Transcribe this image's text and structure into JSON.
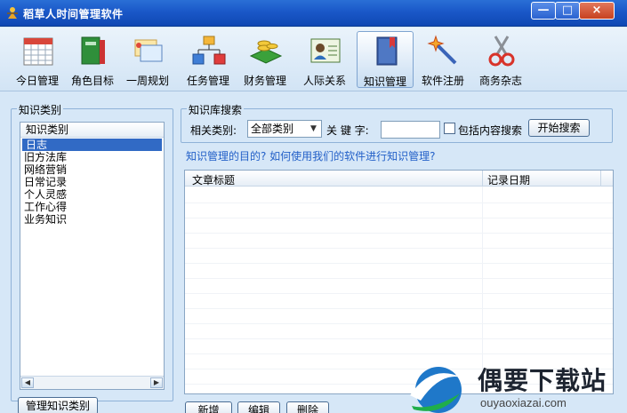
{
  "window": {
    "title": "稻草人时间管理软件",
    "min_label": "—",
    "max_label": "□",
    "close_label": "×"
  },
  "toolbar": [
    {
      "label": "今日管理",
      "icon": "calendar-icon"
    },
    {
      "label": "角色目标",
      "icon": "books-icon"
    },
    {
      "label": "一周规划",
      "icon": "cards-icon"
    },
    {
      "label": "任务管理",
      "icon": "org-chart-icon"
    },
    {
      "label": "财务管理",
      "icon": "coins-icon"
    },
    {
      "label": "人际关系",
      "icon": "contact-card-icon"
    },
    {
      "label": "知识管理",
      "icon": "book-icon",
      "active": true
    },
    {
      "label": "软件注册",
      "icon": "magic-wand-icon"
    },
    {
      "label": "商务杂志",
      "icon": "scissors-icon"
    }
  ],
  "category_panel": {
    "title": "知识类别",
    "header": "知识类别",
    "items": [
      "日志",
      "旧方法库",
      "网络营销",
      "日常记录",
      "个人灵感",
      "工作心得",
      "业务知识"
    ],
    "selected": "日志",
    "manage_button": "管理知识类别"
  },
  "search": {
    "title": "知识库搜索",
    "category_label": "相关类别:",
    "category_value": "全部类别",
    "keyword_label": "关 键 字:",
    "keyword_value": "",
    "include_content_label": "包括内容搜索",
    "search_button": "开始搜索"
  },
  "help_link": "知识管理的目的? 如何使用我们的软件进行知识管理?",
  "table": {
    "columns": [
      "文章标题",
      "记录日期"
    ],
    "rows": []
  },
  "actions": {
    "new": "新增",
    "edit": "编辑",
    "delete": "删除"
  },
  "watermark": {
    "text": "偶要下载站",
    "url": "ouyaoxiazai.com"
  }
}
